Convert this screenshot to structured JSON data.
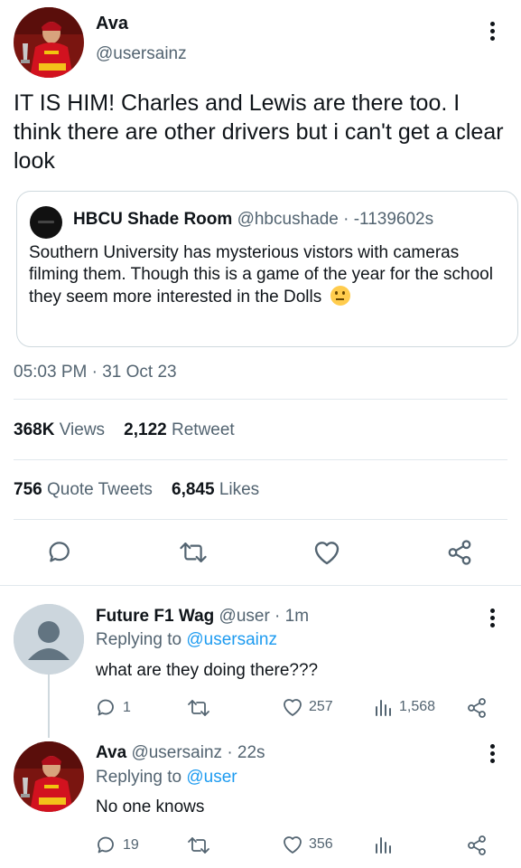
{
  "main_tweet": {
    "name": "Ava",
    "handle": "@usersainz",
    "text": "IT IS HIM! Charles and Lewis are there too. I think there are other drivers but i can't get a clear look",
    "quote": {
      "name": "HBCU Shade Room",
      "handle_time": "@hbcushade · -1139602s",
      "text": "Southern University has mysterious vistors with cameras filming them. Though this is a game of the year  for the school they seem more interested in the Dolls"
    },
    "timestamp": "05:03 PM · 31 Oct 23",
    "stats": {
      "views_count": "368K",
      "views_label": "Views",
      "retweets_count": "2,122",
      "retweets_label": "Retweet",
      "quotes_count": "756",
      "quotes_label": "Quote Tweets",
      "likes_count": "6,845",
      "likes_label": "Likes"
    },
    "actions": [
      "comment-icon",
      "retweet-icon",
      "heart-icon",
      "share-icon"
    ]
  },
  "replies": [
    {
      "name": "Future F1 Wag",
      "handle_time": "@user · 1m",
      "replying_prefix": "Replying to",
      "replying_to": "@usersainz",
      "text": "what are they doing there???",
      "reply_count": "1",
      "retweet_count": "",
      "like_count": "257",
      "view_count": "1,568"
    },
    {
      "name": "Ava",
      "handle_time": "@usersainz · 22s",
      "replying_prefix": "Replying to",
      "replying_to": "@user",
      "text": "No one knows",
      "reply_count": "19",
      "retweet_count": "",
      "like_count": "356",
      "view_count": ""
    }
  ],
  "colors": {
    "text": "#0f1419",
    "muted": "#536471",
    "link": "#1d9bf0",
    "divider": "#e1e8ed",
    "avatar_red": "#c8102e"
  }
}
